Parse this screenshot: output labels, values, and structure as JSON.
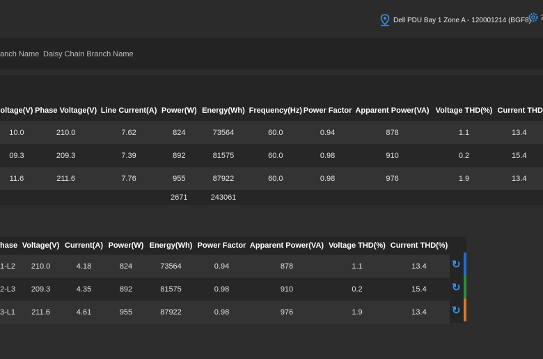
{
  "header": {
    "device_label": "Dell PDU Bay 1 Zone A - 120001214 (BGF8)",
    "gear_text": "2"
  },
  "filters": {
    "branch_name": "anch Name",
    "daisy_chain": "Daisy Chain Branch Name"
  },
  "phase_table": {
    "headers": [
      "oltage(V)",
      "Phase Voltage(V)",
      "Line Current(A)",
      "Power(W)",
      "Energy(Wh)",
      "Frequency(Hz)",
      "Power Factor",
      "Apparent Power(VA)",
      "Voltage THD(%)",
      "Current THD"
    ],
    "rows": [
      [
        "10.0",
        "210.0",
        "7.62",
        "824",
        "73564",
        "60.0",
        "0.94",
        "878",
        "1.1",
        "13.4"
      ],
      [
        "09.3",
        "209.3",
        "7.39",
        "892",
        "81575",
        "60.0",
        "0.98",
        "910",
        "0.2",
        "15.4"
      ],
      [
        "11.6",
        "211.6",
        "7.76",
        "955",
        "87922",
        "60.0",
        "0.98",
        "976",
        "1.9",
        "13.4"
      ]
    ],
    "totals": {
      "power": "2671",
      "energy": "243061"
    }
  },
  "line_table": {
    "headers": [
      "hase",
      "Voltage(V)",
      "Current(A)",
      "Power(W)",
      "Energy(Wh)",
      "Power Factor",
      "Apparent Power(VA)",
      "Voltage THD(%)",
      "Current THD(%)"
    ],
    "rows": [
      [
        "1-L2",
        "210.0",
        "4.18",
        "824",
        "73564",
        "0.94",
        "878",
        "1.1",
        "13.4"
      ],
      [
        "2-L3",
        "209.3",
        "4.35",
        "892",
        "81575",
        "0.98",
        "910",
        "0.2",
        "15.4"
      ],
      [
        "3-L1",
        "211.6",
        "4.61",
        "955",
        "87922",
        "0.98",
        "976",
        "1.9",
        "13.4"
      ]
    ],
    "stripe_colors": [
      "#1f6fd1",
      "#2e8b3a",
      "#d9782a"
    ]
  }
}
